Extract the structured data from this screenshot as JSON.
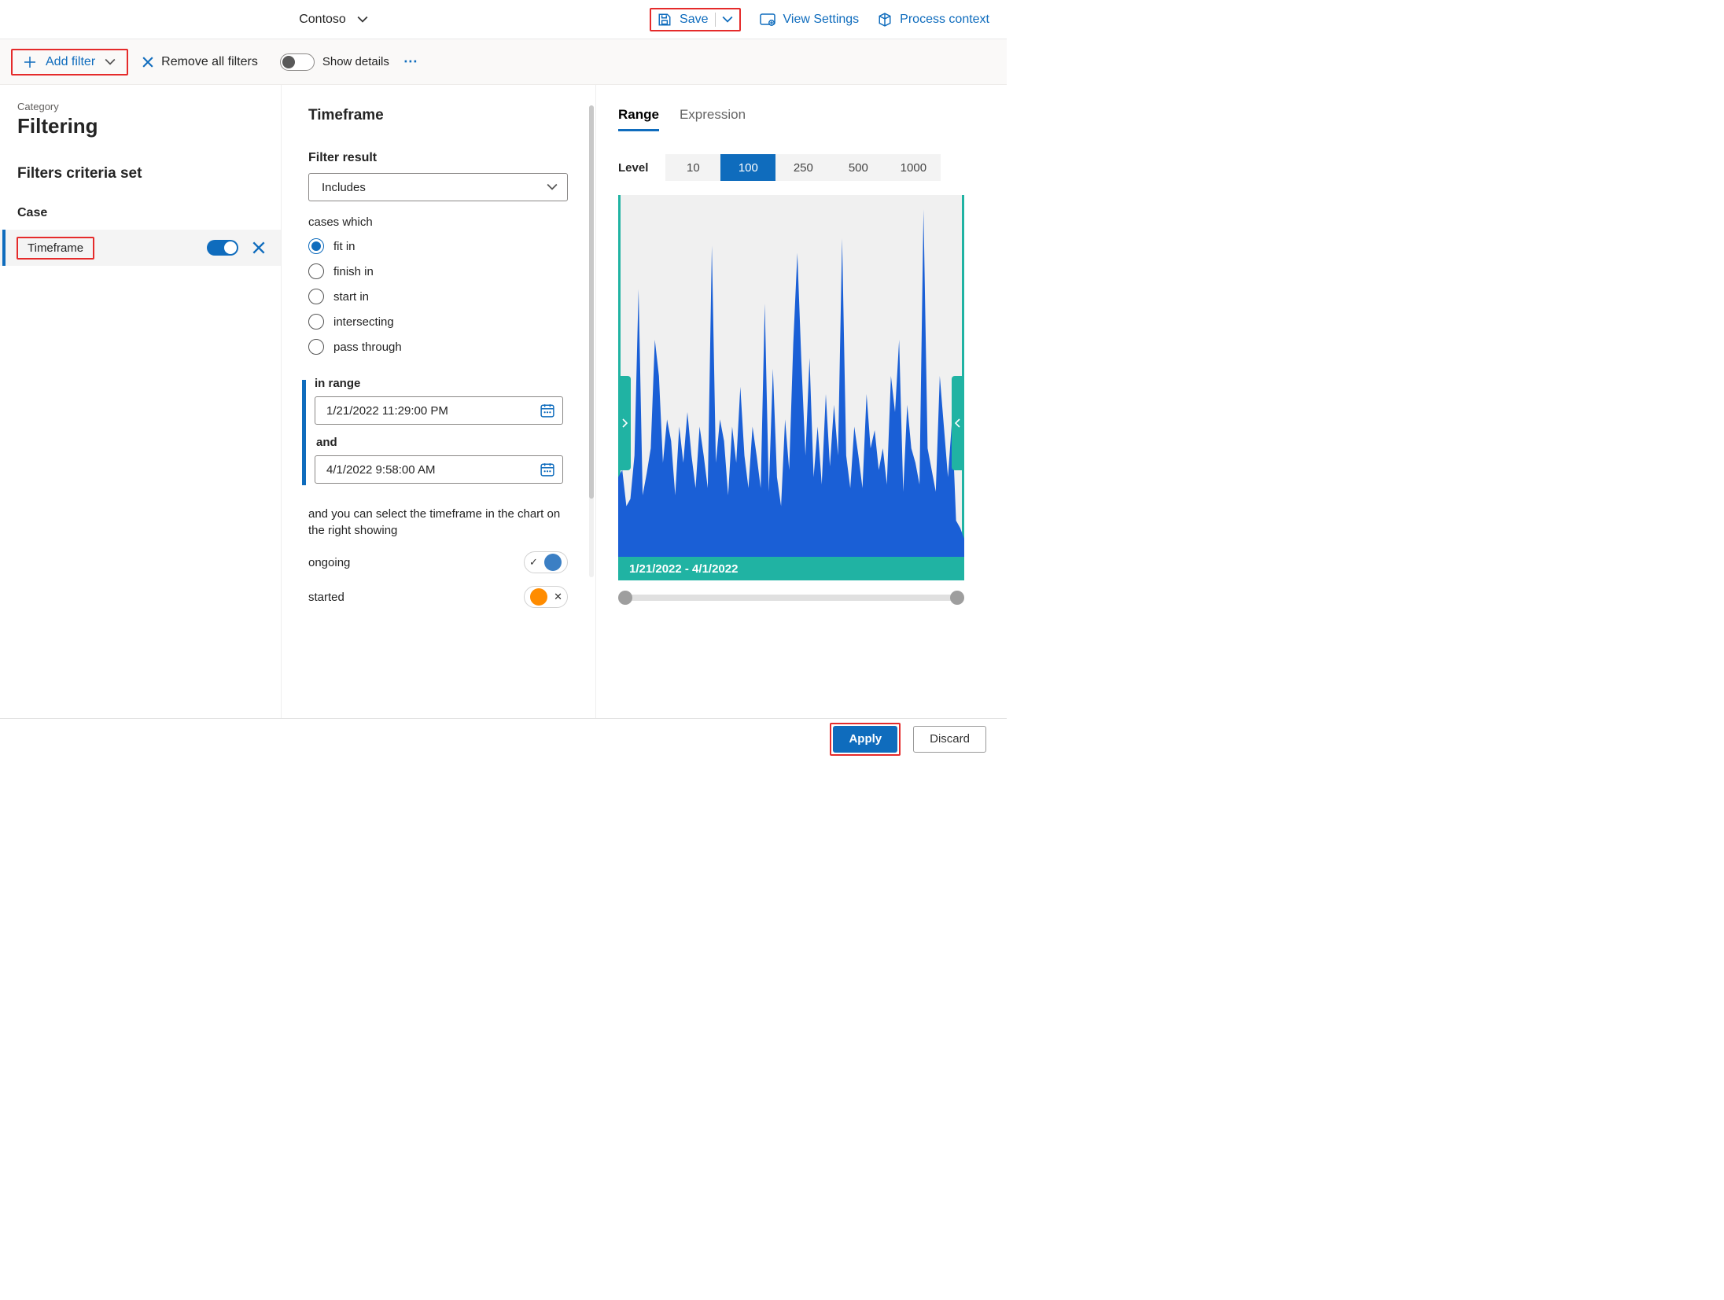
{
  "header": {
    "tenant": "Contoso",
    "save": "Save",
    "view_settings": "View Settings",
    "process_context": "Process context"
  },
  "cmdbar": {
    "add_filter": "Add filter",
    "remove_all": "Remove all filters",
    "show_details": "Show details"
  },
  "category": {
    "label": "Category",
    "title": "Filtering"
  },
  "criteria": {
    "title": "Filters criteria set",
    "group": "Case",
    "active_filter": "Timeframe"
  },
  "timeframe": {
    "title": "Timeframe",
    "filter_result_label": "Filter result",
    "filter_result_value": "Includes",
    "cases_which": "cases which",
    "options": [
      "fit in",
      "finish in",
      "start in",
      "intersecting",
      "pass through"
    ],
    "selected": 0,
    "in_range": "in range",
    "date_from": "1/21/2022 11:29:00 PM",
    "and": "and",
    "date_to": "4/1/2022 9:58:00 AM",
    "help": "and you can select the timeframe in the chart on the right showing",
    "row_ongoing": "ongoing",
    "row_started": "started"
  },
  "range": {
    "tab_range": "Range",
    "tab_expr": "Expression",
    "level": "Level",
    "level_opts": [
      "10",
      "100",
      "250",
      "500",
      "1000"
    ],
    "level_selected": 1,
    "caption": "1/21/2022 - 4/1/2022"
  },
  "footer": {
    "apply": "Apply",
    "discard": "Discard"
  },
  "chart_data": {
    "type": "area",
    "title": "",
    "xlabel": "",
    "ylabel": "",
    "ylim": [
      0,
      100
    ],
    "x_range": [
      "1/21/2022",
      "4/1/2022"
    ],
    "values": [
      22,
      24,
      14,
      16,
      28,
      74,
      17,
      23,
      30,
      60,
      50,
      26,
      38,
      32,
      17,
      36,
      26,
      40,
      28,
      19,
      36,
      28,
      19,
      86,
      26,
      38,
      32,
      17,
      36,
      26,
      47,
      28,
      19,
      36,
      28,
      19,
      70,
      18,
      52,
      22,
      14,
      38,
      24,
      59,
      84,
      54,
      28,
      55,
      22,
      36,
      20,
      45,
      25,
      42,
      28,
      88,
      28,
      19,
      36,
      28,
      19,
      45,
      30,
      35,
      24,
      30,
      20,
      50,
      40,
      60,
      18,
      42,
      30,
      26,
      20,
      96,
      30,
      24,
      18,
      50,
      36,
      22,
      38,
      10,
      8,
      5
    ]
  }
}
